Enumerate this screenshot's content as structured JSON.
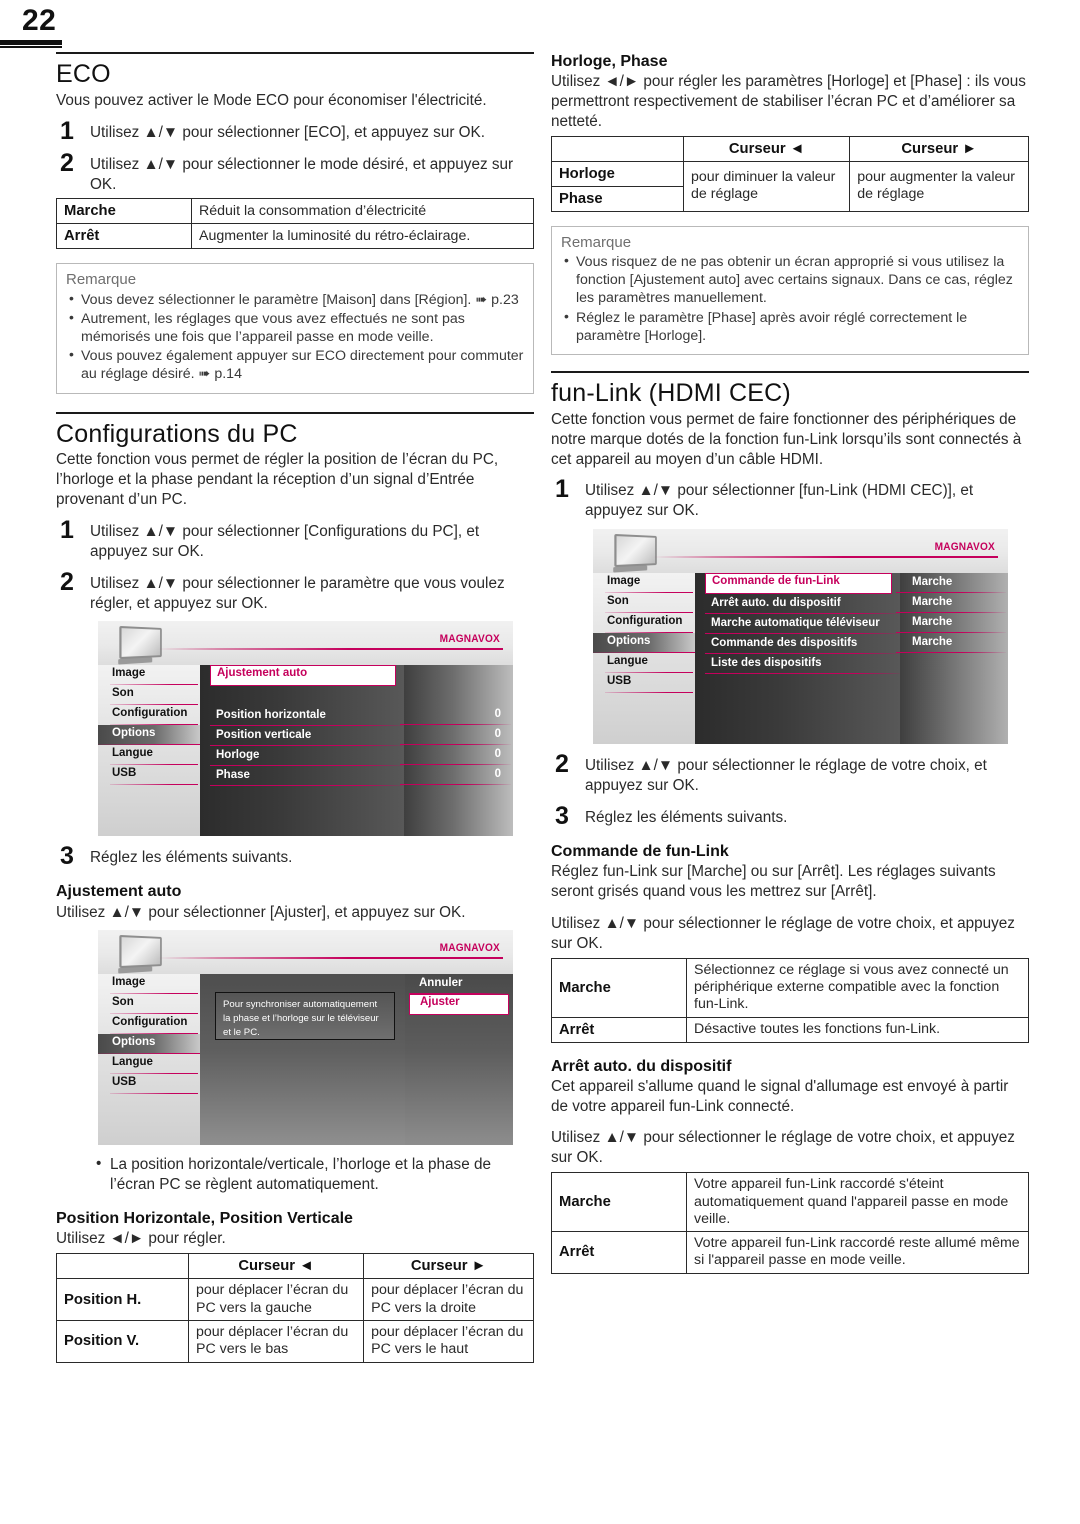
{
  "page": {
    "number": "22"
  },
  "left": {
    "eco": {
      "heading": "ECO",
      "intro": "Vous pouvez activer le Mode ECO pour économiser l'électricité.",
      "steps": [
        {
          "n": "1",
          "text": "Utilisez ▲/▼ pour sélectionner [ECO], et appuyez sur OK."
        },
        {
          "n": "2",
          "text": "Utilisez ▲/▼ pour sélectionner le mode désiré, et appuyez sur OK."
        }
      ],
      "table": [
        {
          "key": "Marche",
          "desc": "Réduit la consommation d’électricité"
        },
        {
          "key": "Arrêt",
          "desc": "Augmenter la luminosité du rétro-éclairage."
        }
      ],
      "remark": {
        "title": "Remarque",
        "items": [
          "Vous devez sélectionner le paramètre [Maison] dans [Région]. ➠ p.23",
          "Autrement, les réglages que vous avez effectués ne sont pas mémorisés une fois que l’appareil passe en mode veille.",
          "Vous pouvez également appuyer sur ECO directement pour commuter au réglage désiré. ➠ p.14"
        ]
      }
    },
    "pc": {
      "heading": "Configurations du PC",
      "intro": "Cette fonction vous permet de régler la position de l’écran du PC, l’horloge et la phase pendant la réception d’un signal d’Entrée provenant d’un PC.",
      "steps": [
        {
          "n": "1",
          "text": "Utilisez ▲/▼ pour sélectionner [Configurations du PC], et appuyez sur OK."
        },
        {
          "n": "2",
          "text": "Utilisez ▲/▼ pour sélectionner le paramètre que vous voulez régler, et appuyez sur OK."
        }
      ],
      "step3": {
        "n": "3",
        "text": "Réglez les éléments suivants."
      },
      "osd1": {
        "brand": "MAGNAVOX",
        "sidebar": [
          "Image",
          "Son",
          "Configuration",
          "Options",
          "Langue",
          "USB"
        ],
        "selected_sidebar": "Options",
        "rows": [
          {
            "label": "Ajustement auto",
            "value": "",
            "highlight": true
          },
          {
            "label": "",
            "value": "",
            "blank": true
          },
          {
            "label": "Position horizontale",
            "value": "0"
          },
          {
            "label": "Position verticale",
            "value": "0"
          },
          {
            "label": "Horloge",
            "value": "0"
          },
          {
            "label": "Phase",
            "value": "0"
          }
        ]
      },
      "ajustement": {
        "heading": "Ajustement auto",
        "text": "Utilisez ▲/▼ pour sélectionner [Ajuster], et appuyez sur OK.",
        "osd2": {
          "brand": "MAGNAVOX",
          "sidebar": [
            "Image",
            "Son",
            "Configuration",
            "Options",
            "Langue",
            "USB"
          ],
          "selected_sidebar": "Options",
          "dialog": "Pour synchroniser automatiquement la phase et l’horloge sur le téléviseur et le PC.",
          "options": [
            {
              "label": "Annuler",
              "highlight": false
            },
            {
              "label": "Ajuster",
              "highlight": true
            }
          ]
        },
        "bullet": "La position horizontale/verticale, l’horloge et la phase de l’écran PC se règlent automatiquement."
      },
      "position": {
        "heading": "Position Horizontale, Position Verticale",
        "intro": "Utilisez ◄/► pour régler.",
        "headers": [
          "",
          "Curseur ◄",
          "Curseur ►"
        ],
        "rows": [
          {
            "key": "Position H.",
            "left": "pour déplacer l’écran du PC vers la gauche",
            "right": "pour déplacer l’écran du PC vers la droite"
          },
          {
            "key": "Position V.",
            "left": "pour déplacer l’écran du PC vers le bas",
            "right": "pour déplacer l’écran du PC vers le haut"
          }
        ]
      }
    }
  },
  "right": {
    "horloge": {
      "heading": "Horloge, Phase",
      "intro": "Utilisez ◄/► pour régler les paramètres [Horloge] et [Phase] : ils vous permettront respectivement de stabiliser l’écran PC et d’améliorer sa netteté.",
      "headers": [
        "",
        "Curseur ◄",
        "Curseur ►"
      ],
      "keys": [
        "Horloge",
        "Phase"
      ],
      "left_desc": "pour diminuer la valeur de réglage",
      "right_desc": "pour augmenter la valeur de réglage",
      "remark": {
        "title": "Remarque",
        "items": [
          "Vous risquez de ne pas obtenir un écran approprié si vous utilisez la fonction [Ajustement auto] avec certains signaux. Dans ce cas, réglez les paramètres manuellement.",
          "Réglez le paramètre [Phase] après avoir réglé correctement le paramètre [Horloge]."
        ]
      }
    },
    "funlink": {
      "heading": "fun-Link (HDMI CEC)",
      "intro": "Cette fonction vous permet de faire fonctionner des périphériques de notre marque dotés de la fonction fun-Link lorsqu’ils sont connectés à cet appareil au moyen d’un câble HDMI.",
      "step1": {
        "n": "1",
        "text": "Utilisez ▲/▼ pour sélectionner [fun-Link (HDMI CEC)], et appuyez sur OK."
      },
      "osd3": {
        "brand": "MAGNAVOX",
        "sidebar": [
          "Image",
          "Son",
          "Configuration",
          "Options",
          "Langue",
          "USB"
        ],
        "selected_sidebar": "Options",
        "rows": [
          {
            "label": "Commande de fun-Link",
            "value": "Marche",
            "highlight": true
          },
          {
            "label": "Arrêt auto. du dispositif",
            "value": "Marche"
          },
          {
            "label": "Marche automatique téléviseur",
            "value": "Marche"
          },
          {
            "label": "Commande des dispositifs",
            "value": "Marche"
          },
          {
            "label": "Liste des dispositifs",
            "value": ""
          }
        ]
      },
      "step2": {
        "n": "2",
        "text": "Utilisez ▲/▼ pour sélectionner le réglage de votre choix, et appuyez sur OK."
      },
      "step3": {
        "n": "3",
        "text": "Réglez les éléments suivants."
      },
      "commande": {
        "heading": "Commande de fun-Link",
        "intro": "Réglez fun-Link sur [Marche] ou sur [Arrêt]. Les réglages suivants seront grisés quand vous les mettrez sur [Arrêt].",
        "instruction": "Utilisez ▲/▼ pour sélectionner le réglage de votre choix, et appuyez sur OK.",
        "table": [
          {
            "key": "Marche",
            "desc": "Sélectionnez ce réglage si vous avez connecté un périphérique externe compatible avec la fonction fun-Link."
          },
          {
            "key": "Arrêt",
            "desc": "Désactive toutes les fonctions fun-Link."
          }
        ]
      },
      "arret": {
        "heading": "Arrêt auto. du dispositif",
        "intro": "Cet appareil s'allume quand le signal d'allumage est envoyé à partir de votre appareil fun-Link connecté.",
        "instruction": "Utilisez ▲/▼ pour sélectionner le réglage de votre choix, et appuyez sur OK.",
        "table": [
          {
            "key": "Marche",
            "desc": "Votre appareil fun-Link raccordé s'éteint automatiquement quand l'appareil passe en mode veille."
          },
          {
            "key": "Arrêt",
            "desc": "Votre appareil fun-Link raccordé reste allumé même si l'appareil passe en mode veille."
          }
        ]
      }
    }
  },
  "colors": {
    "accent": "#c5005c",
    "text": "#1a1a1a"
  }
}
